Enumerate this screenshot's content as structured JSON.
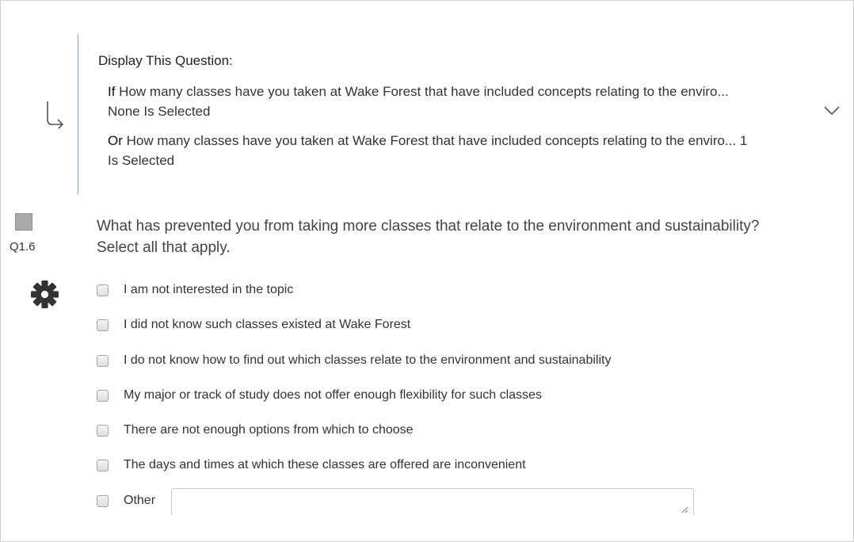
{
  "display_logic": {
    "title": "Display This Question:",
    "conditions": [
      {
        "keyword": "If",
        "text": " How many classes have you taken at Wake Forest that have included concepts relating to the enviro... None Is Selected"
      },
      {
        "keyword": "Or",
        "text": " How many classes have you taken at Wake Forest that have included concepts relating to the enviro... 1 Is Selected"
      }
    ]
  },
  "question": {
    "number": "Q1.6",
    "text": "What has prevented you from taking more classes that relate to the environment and sustainability? Select all that apply.",
    "choices": [
      "I am not interested in the topic",
      "I did not know such classes existed at Wake Forest",
      "I do not know how to find out which classes relate to the environment and sustainability",
      "My major or track of study does not offer enough flexibility for such classes",
      "There are not enough options from which to choose",
      "The days and times at which these classes are offered are inconvenient",
      "Other"
    ],
    "other_value": ""
  },
  "icons": {
    "logic_arrow": "arrow-turn-down-right-icon",
    "expand": "chevron-down-icon",
    "settings": "gear-icon",
    "resize": "resize-handle-icon"
  },
  "colors": {
    "logic_border": "#7aa2c6",
    "question_checkbox": "#a9a9a9"
  }
}
